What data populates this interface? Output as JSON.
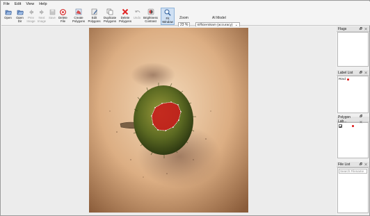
{
  "menu": [
    "File",
    "Edit",
    "View",
    "Help"
  ],
  "toolbar": [
    {
      "label": "Open",
      "icon": "open-folder-icon",
      "enabled": true
    },
    {
      "label": "Open\nDir",
      "icon": "open-dir-icon",
      "enabled": true
    },
    {
      "label": "Prev\nImage",
      "icon": "prev-arrow-icon",
      "enabled": false
    },
    {
      "label": "Next\nImage",
      "icon": "next-arrow-icon",
      "enabled": false
    },
    {
      "label": "Save",
      "icon": "save-icon",
      "enabled": false
    },
    {
      "label": "Delete\nFile",
      "icon": "delete-file-icon",
      "enabled": true
    },
    {
      "label": "Create\nPolygons",
      "icon": "create-polygon-icon",
      "enabled": true
    },
    {
      "label": "Edit\nPolygons",
      "icon": "edit-polygon-icon",
      "enabled": true
    },
    {
      "label": "Duplicate\nPolygons",
      "icon": "duplicate-icon",
      "enabled": true
    },
    {
      "label": "Delete\nPolygons",
      "icon": "delete-polygon-icon",
      "enabled": true
    },
    {
      "label": "Undo",
      "icon": "undo-icon",
      "enabled": false
    },
    {
      "label": "Brightness\nContrast",
      "icon": "brightness-icon",
      "enabled": true
    },
    {
      "label": "Fit\nWindow",
      "icon": "fit-window-icon",
      "enabled": true,
      "active": true
    }
  ],
  "zoom": {
    "label": "Zoom",
    "value": "23 %"
  },
  "ai_model": {
    "label": "AI Model",
    "value": "EfficientSam (accuracy)"
  },
  "docks": {
    "flags": {
      "title": "Flags"
    },
    "label_list": {
      "title": "Label List",
      "items": [
        {
          "label": "Rind",
          "color": "#dd1111"
        }
      ]
    },
    "polygon_labels": {
      "title": "Polygon Lab...",
      "items": [
        {
          "checked": true,
          "color": "#dd1111"
        }
      ]
    },
    "file_list": {
      "title": "File List",
      "search_placeholder": "Search Filename"
    }
  },
  "dock_buttons": "🗗 ✕"
}
